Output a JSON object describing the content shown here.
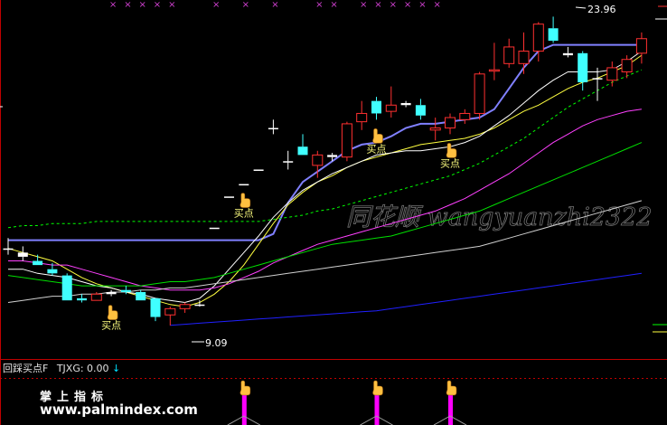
{
  "chart_data": {
    "type": "candlestick",
    "price_high_label": "23.96",
    "price_low_label": "9.09",
    "watermark": "同花顺 wangyuanzhi2322",
    "buy_signal_label": "买点",
    "buy_signal_icon": "pointing-hand-icon",
    "buy_signal_slots": [
      7,
      16,
      25,
      30
    ],
    "signal_color": "#ff00ff",
    "x_marks": [
      7,
      8,
      9,
      10,
      11,
      14,
      16,
      18,
      21,
      22,
      24,
      25,
      26,
      27,
      28,
      29
    ],
    "candles": [
      {
        "o": 12.8,
        "h": 13.3,
        "l": 12.5,
        "c": 12.8,
        "color": "white"
      },
      {
        "o": 12.4,
        "h": 12.9,
        "l": 12.2,
        "c": 12.6,
        "color": "white"
      },
      {
        "o": 12.2,
        "h": 12.5,
        "l": 12.0,
        "c": 12.0,
        "color": "cyan"
      },
      {
        "o": 11.8,
        "h": 12.1,
        "l": 11.5,
        "c": 11.6,
        "color": "cyan"
      },
      {
        "o": 11.5,
        "h": 11.6,
        "l": 10.3,
        "c": 10.3,
        "color": "cyan"
      },
      {
        "o": 10.4,
        "h": 10.6,
        "l": 10.2,
        "c": 10.3,
        "color": "cyan"
      },
      {
        "o": 10.3,
        "h": 10.7,
        "l": 10.3,
        "c": 10.6,
        "color": "red"
      },
      {
        "o": 10.7,
        "h": 10.8,
        "l": 10.5,
        "c": 10.6,
        "color": "white"
      },
      {
        "o": 10.8,
        "h": 11.0,
        "l": 10.6,
        "c": 10.7,
        "color": "cyan"
      },
      {
        "o": 10.7,
        "h": 10.8,
        "l": 10.3,
        "c": 10.3,
        "color": "cyan"
      },
      {
        "o": 10.4,
        "h": 10.4,
        "l": 9.3,
        "c": 9.5,
        "color": "cyan"
      },
      {
        "o": 9.6,
        "h": 10.0,
        "l": 9.09,
        "c": 9.9,
        "color": "red"
      },
      {
        "o": 9.9,
        "h": 10.2,
        "l": 9.7,
        "c": 10.1,
        "color": "red"
      },
      {
        "o": 10.1,
        "h": 10.3,
        "l": 10.0,
        "c": 10.1,
        "color": "white"
      },
      {
        "o": 13.8,
        "h": 13.8,
        "l": 13.8,
        "c": 13.8,
        "color": "white"
      },
      {
        "o": 15.3,
        "h": 15.3,
        "l": 15.3,
        "c": 15.3,
        "color": "white"
      },
      {
        "o": 15.9,
        "h": 15.9,
        "l": 15.9,
        "c": 15.9,
        "color": "white"
      },
      {
        "o": 16.6,
        "h": 16.6,
        "l": 16.6,
        "c": 16.6,
        "color": "white"
      },
      {
        "o": 18.6,
        "h": 19.0,
        "l": 18.3,
        "c": 18.6,
        "color": "white"
      },
      {
        "o": 17.0,
        "h": 17.5,
        "l": 16.6,
        "c": 17.0,
        "color": "white"
      },
      {
        "o": 17.7,
        "h": 18.3,
        "l": 17.3,
        "c": 17.3,
        "color": "cyan"
      },
      {
        "o": 16.8,
        "h": 17.5,
        "l": 16.2,
        "c": 17.3,
        "color": "red"
      },
      {
        "o": 17.3,
        "h": 17.4,
        "l": 17.0,
        "c": 17.2,
        "color": "white"
      },
      {
        "o": 17.2,
        "h": 18.9,
        "l": 17.0,
        "c": 18.8,
        "color": "red"
      },
      {
        "o": 18.9,
        "h": 19.9,
        "l": 18.5,
        "c": 19.3,
        "color": "red"
      },
      {
        "o": 19.9,
        "h": 20.1,
        "l": 19.0,
        "c": 19.3,
        "color": "cyan"
      },
      {
        "o": 19.4,
        "h": 20.6,
        "l": 19.1,
        "c": 19.7,
        "color": "red"
      },
      {
        "o": 19.7,
        "h": 19.9,
        "l": 19.6,
        "c": 19.8,
        "color": "white"
      },
      {
        "o": 19.7,
        "h": 20.0,
        "l": 19.0,
        "c": 19.2,
        "color": "cyan"
      },
      {
        "o": 18.5,
        "h": 19.1,
        "l": 18.0,
        "c": 18.6,
        "color": "red"
      },
      {
        "o": 18.6,
        "h": 19.3,
        "l": 18.3,
        "c": 19.1,
        "color": "red"
      },
      {
        "o": 19.0,
        "h": 19.5,
        "l": 18.8,
        "c": 19.3,
        "color": "red"
      },
      {
        "o": 19.3,
        "h": 21.3,
        "l": 19.0,
        "c": 21.2,
        "color": "red"
      },
      {
        "o": 21.4,
        "h": 22.7,
        "l": 20.9,
        "c": 21.4,
        "color": "red"
      },
      {
        "o": 21.7,
        "h": 22.9,
        "l": 21.5,
        "c": 22.5,
        "color": "red"
      },
      {
        "o": 21.7,
        "h": 23.2,
        "l": 21.2,
        "c": 22.3,
        "color": "red"
      },
      {
        "o": 22.3,
        "h": 23.7,
        "l": 21.8,
        "c": 23.6,
        "color": "red"
      },
      {
        "o": 22.8,
        "h": 23.96,
        "l": 22.7,
        "c": 23.4,
        "color": "cyan"
      },
      {
        "o": 22.2,
        "h": 22.5,
        "l": 22.0,
        "c": 22.1,
        "color": "white"
      },
      {
        "o": 22.2,
        "h": 22.3,
        "l": 20.4,
        "c": 20.8,
        "color": "cyan"
      },
      {
        "o": 21.0,
        "h": 21.5,
        "l": 19.9,
        "c": 21.0,
        "color": "white"
      },
      {
        "o": 20.9,
        "h": 21.8,
        "l": 20.6,
        "c": 21.5,
        "color": "red"
      },
      {
        "o": 21.3,
        "h": 22.1,
        "l": 21.0,
        "c": 21.9,
        "color": "red"
      },
      {
        "o": 22.2,
        "h": 23.2,
        "l": 21.7,
        "c": 22.9,
        "color": "red"
      }
    ],
    "series": [
      {
        "color": "#8080ff",
        "values": [
          13.2,
          13.2,
          13.2,
          13.2,
          13.2,
          13.2,
          13.2,
          13.2,
          13.2,
          13.2,
          13.2,
          13.2,
          13.2,
          13.2,
          13.2,
          13.2,
          13.2,
          13.2,
          13.5,
          15.0,
          16.0,
          16.5,
          17.0,
          17.5,
          17.8,
          17.9,
          18.2,
          18.6,
          18.8,
          18.8,
          18.9,
          19.0,
          19.1,
          19.5,
          20.5,
          21.5,
          22.3,
          22.6,
          22.6,
          22.6,
          22.6,
          22.6,
          22.6,
          22.6
        ]
      },
      {
        "color": "#ffff40",
        "values": [
          12.8,
          12.6,
          12.4,
          12.2,
          11.8,
          11.4,
          11.1,
          10.9,
          10.7,
          10.5,
          10.3,
          10.1,
          10.0,
          10.2,
          10.6,
          11.2,
          12.0,
          13.0,
          14.0,
          14.9,
          15.5,
          16.0,
          16.3,
          16.7,
          17.0,
          17.2,
          17.4,
          17.6,
          17.8,
          17.9,
          18.0,
          18.1,
          18.3,
          18.6,
          19.0,
          19.4,
          19.7,
          20.1,
          20.5,
          20.8,
          21.0,
          21.3,
          21.6,
          22.1
        ]
      },
      {
        "color": "#ffffff",
        "values": [
          11.8,
          11.8,
          11.6,
          11.5,
          11.4,
          11.2,
          11.0,
          10.9,
          10.7,
          10.6,
          10.4,
          10.3,
          10.2,
          10.4,
          11.0,
          11.8,
          12.6,
          13.4,
          14.3,
          15.0,
          15.6,
          16.0,
          16.4,
          16.7,
          17.0,
          17.3,
          17.4,
          17.5,
          17.5,
          17.6,
          17.7,
          17.9,
          18.2,
          18.7,
          19.2,
          19.8,
          20.4,
          20.9,
          21.3,
          21.3,
          21.3,
          21.4,
          21.8,
          22.3
        ]
      },
      {
        "color": "#00ff00",
        "dashed": true,
        "values": [
          13.8,
          13.9,
          13.9,
          14.0,
          14.0,
          14.0,
          14.1,
          14.1,
          14.1,
          14.1,
          14.1,
          14.1,
          14.1,
          14.1,
          14.1,
          14.1,
          14.1,
          14.1,
          14.2,
          14.3,
          14.4,
          14.6,
          14.7,
          14.9,
          15.1,
          15.3,
          15.5,
          15.7,
          15.9,
          16.1,
          16.3,
          16.6,
          16.9,
          17.3,
          17.7,
          18.1,
          18.6,
          19.1,
          19.6,
          20.0,
          20.4,
          20.8,
          21.1,
          21.4
        ]
      },
      {
        "color": "#ff40ff",
        "values": [
          12.2,
          12.2,
          12.1,
          12.0,
          12.0,
          11.8,
          11.6,
          11.4,
          11.2,
          11.0,
          10.9,
          10.8,
          10.8,
          10.8,
          10.9,
          11.1,
          11.4,
          11.7,
          12.1,
          12.4,
          12.7,
          13.0,
          13.2,
          13.4,
          13.6,
          13.8,
          14.0,
          14.2,
          14.4,
          14.6,
          14.9,
          15.2,
          15.6,
          16.0,
          16.4,
          16.9,
          17.4,
          17.9,
          18.3,
          18.7,
          19.0,
          19.2,
          19.4,
          19.5
        ]
      },
      {
        "color": "#00e000",
        "values": [
          11.5,
          11.4,
          11.3,
          11.2,
          11.1,
          11.0,
          11.0,
          11.0,
          11.0,
          11.0,
          11.1,
          11.2,
          11.2,
          11.3,
          11.4,
          11.6,
          11.8,
          12.0,
          12.2,
          12.4,
          12.6,
          12.8,
          13.0,
          13.1,
          13.2,
          13.3,
          13.4,
          13.6,
          13.8,
          14.0,
          14.2,
          14.4,
          14.6,
          14.9,
          15.2,
          15.5,
          15.8,
          16.1,
          16.4,
          16.7,
          17.0,
          17.3,
          17.6,
          17.9
        ]
      },
      {
        "color": "#d0d0d0",
        "values": [
          10.2,
          10.3,
          10.4,
          10.5,
          10.5,
          10.6,
          10.6,
          10.7,
          10.7,
          10.8,
          10.8,
          10.9,
          10.9,
          11.0,
          11.1,
          11.2,
          11.3,
          11.4,
          11.5,
          11.6,
          11.7,
          11.8,
          11.9,
          12.0,
          12.1,
          12.2,
          12.3,
          12.4,
          12.5,
          12.6,
          12.7,
          12.8,
          12.9,
          13.1,
          13.3,
          13.5,
          13.7,
          13.9,
          14.1,
          14.3,
          14.5,
          14.7,
          14.9,
          15.1
        ]
      },
      {
        "color": "#2020ff",
        "start": 11,
        "values": [
          9.1,
          9.15,
          9.2,
          9.25,
          9.3,
          9.35,
          9.4,
          9.45,
          9.5,
          9.55,
          9.6,
          9.65,
          9.7,
          9.75,
          9.8,
          9.9,
          10.0,
          10.1,
          10.2,
          10.3,
          10.4,
          10.5,
          10.6,
          10.7,
          10.8,
          10.9,
          11.0,
          11.1,
          11.2,
          11.3,
          11.4,
          11.5,
          11.6
        ]
      }
    ],
    "ylim": [
      8.0,
      24.5
    ]
  },
  "sub_panel": {
    "indicator_label": "回踩买点F",
    "value_label": "TJXG: 0.00",
    "arrow_glyph": "↓"
  },
  "branding": {
    "brand_text": "掌上指标",
    "site_text": "www.palmindex.com"
  }
}
